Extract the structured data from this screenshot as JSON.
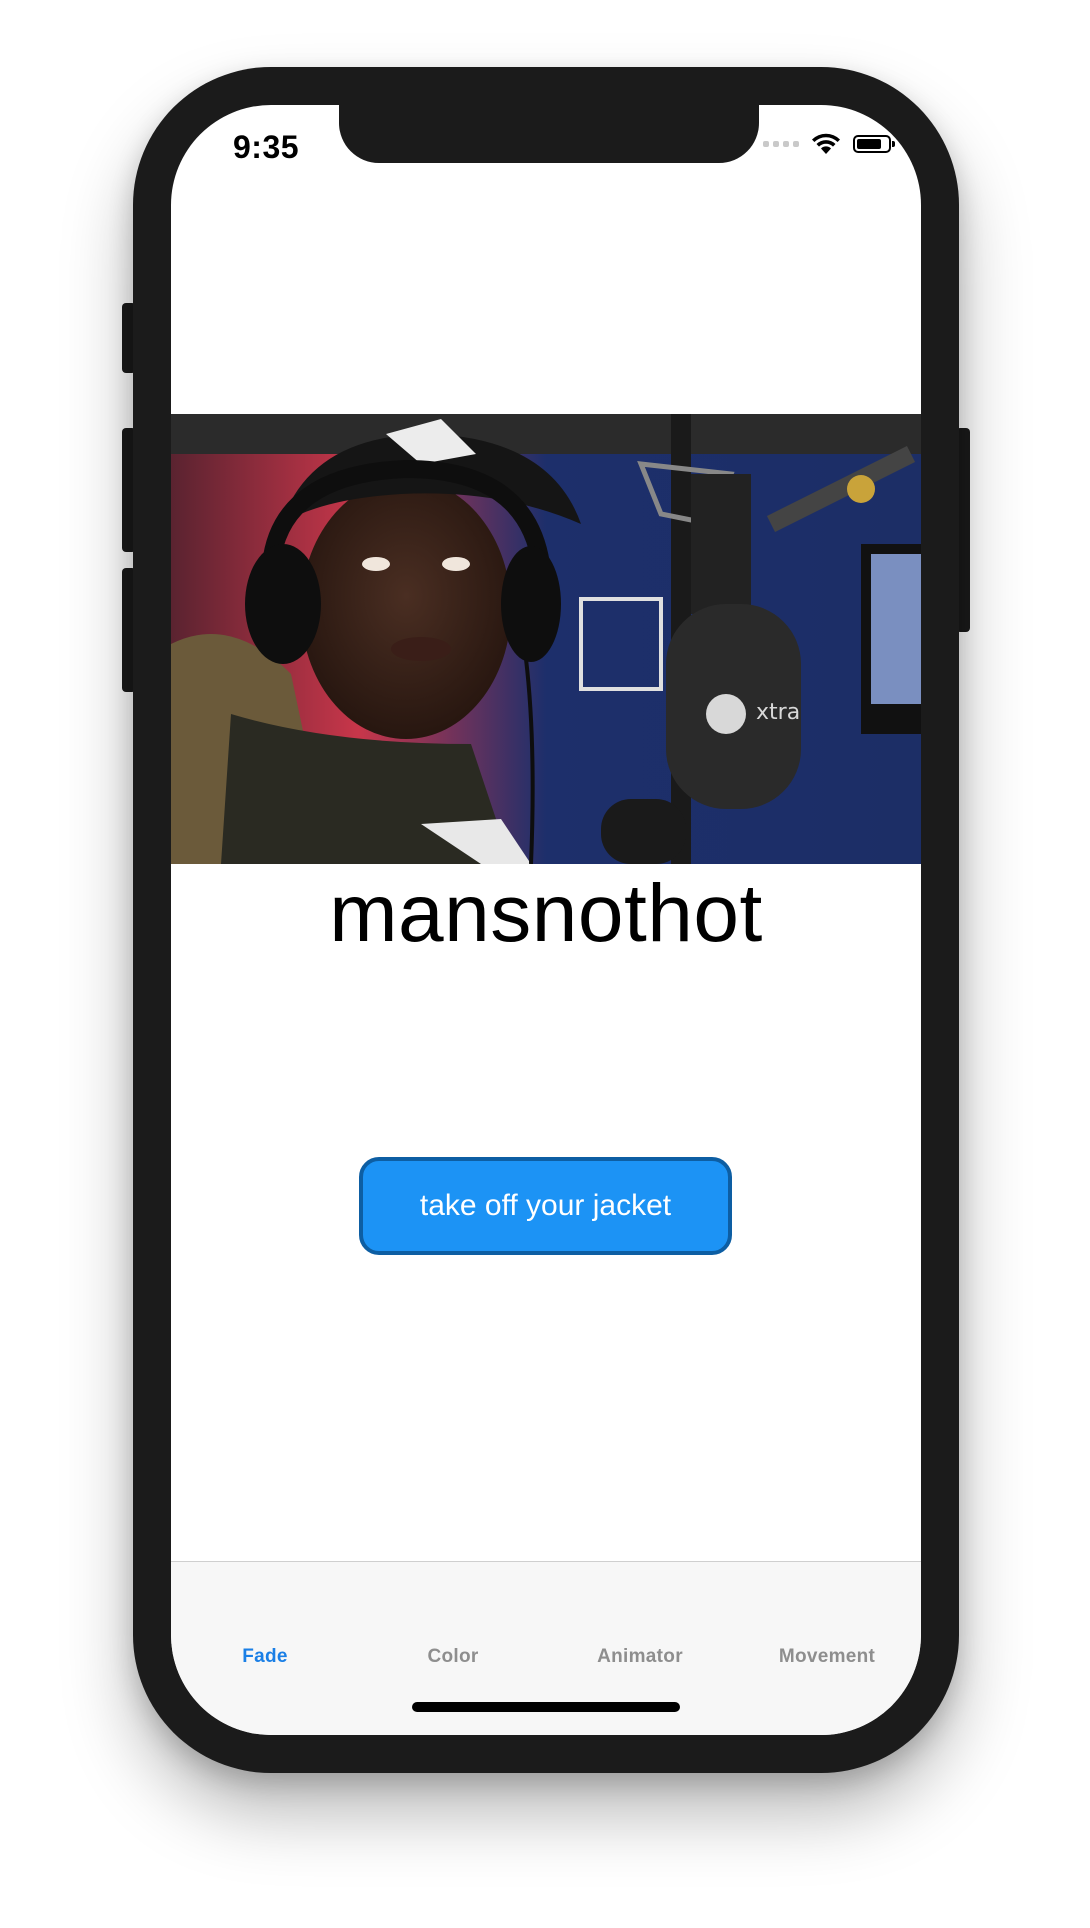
{
  "status_bar": {
    "time": "9:35"
  },
  "main": {
    "title": "mansnothot",
    "image_description_icon": "photo-image",
    "action_button_label": "take off your jacket"
  },
  "tabbar": {
    "tabs": [
      {
        "label": "Fade",
        "active": true
      },
      {
        "label": "Color",
        "active": false
      },
      {
        "label": "Animator",
        "active": false
      },
      {
        "label": "Movement",
        "active": false
      }
    ]
  },
  "colors": {
    "accent": "#1a7fe6",
    "button": "#1c93f5",
    "button_border": "#0d5ea3",
    "inactive_tab": "#8e8e8e"
  }
}
